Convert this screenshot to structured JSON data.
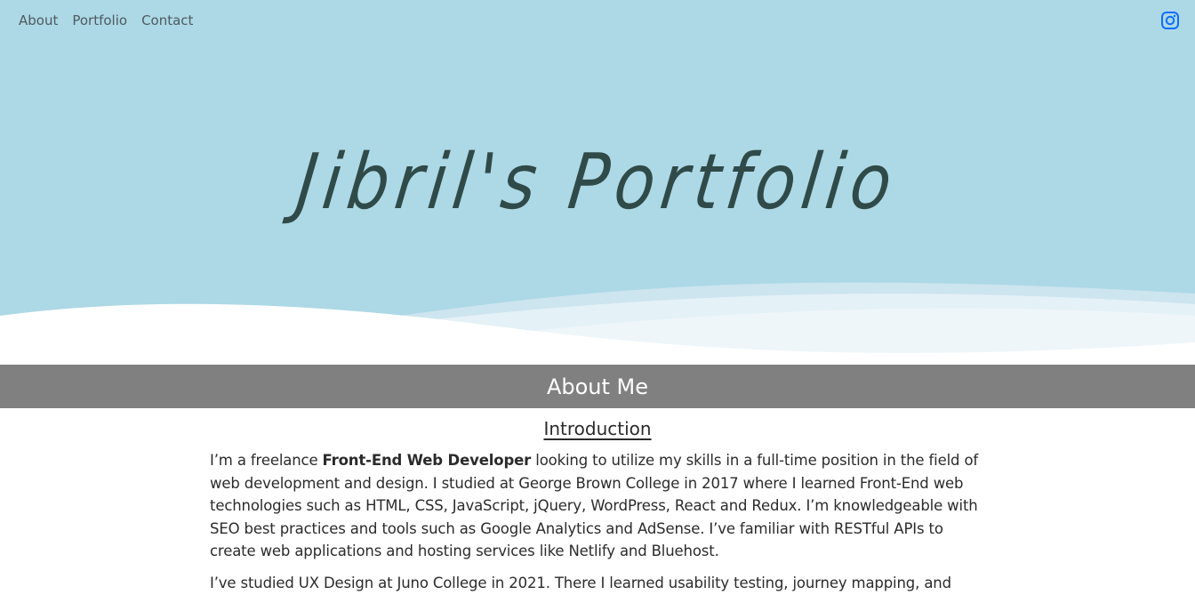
{
  "nav": {
    "links": [
      "About",
      "Portfolio",
      "Contact"
    ]
  },
  "social": {
    "icon": "instagram-icon",
    "color": "#0d6efd"
  },
  "hero": {
    "title": "Jibril's Portfolio",
    "background": "#add8e6",
    "title_color": "#2f4a48"
  },
  "about": {
    "section_title": "About Me",
    "bar_color": "#808080",
    "subheading": "Introduction",
    "para1": {
      "before": "I’m a freelance ",
      "bold": "Front-End Web Developer",
      "after": " looking to utilize my skills in a full-time position in the field of web development and design. I studied at George Brown College in 2017 where I learned Front-End web technologies such as HTML, CSS, JavaScript, jQuery, WordPress, React and Redux. I’m knowledgeable with SEO best practices and tools such as Google Analytics and AdSense. I’ve familiar with RESTful APIs to create web applications and hosting services like Netlify and Bluehost."
    },
    "para2": "I’ve studied UX Design at Juno College in 2021. There I learned usability testing, journey mapping, and"
  }
}
